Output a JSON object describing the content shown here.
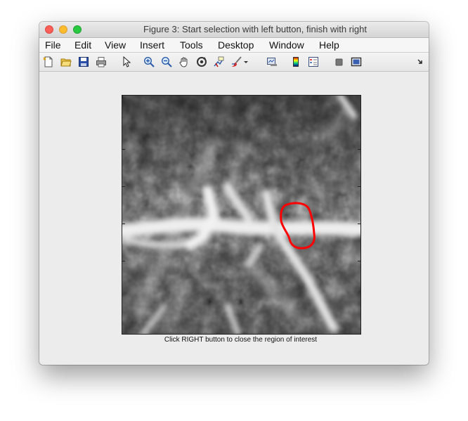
{
  "window": {
    "title": "Figure 3: Start selection with left button, finish with right"
  },
  "menu": {
    "items": [
      "File",
      "Edit",
      "View",
      "Insert",
      "Tools",
      "Desktop",
      "Window",
      "Help"
    ]
  },
  "toolbar": {
    "icons": [
      "new-figure-icon",
      "open-file-icon",
      "save-icon",
      "print-icon",
      "pointer-icon",
      "zoom-in-icon",
      "zoom-out-icon",
      "pan-icon",
      "rotate-3d-icon",
      "data-cursor-icon",
      "brush-icon",
      "brush-dropdown-icon",
      "link-plot-icon",
      "colorbar-icon",
      "legend-icon",
      "hide-plot-tools-icon",
      "show-plot-tools-icon",
      "dock-icon"
    ]
  },
  "figure": {
    "roi_color": "#ff0000",
    "caption": "Click RIGHT button to close the region of interest"
  }
}
